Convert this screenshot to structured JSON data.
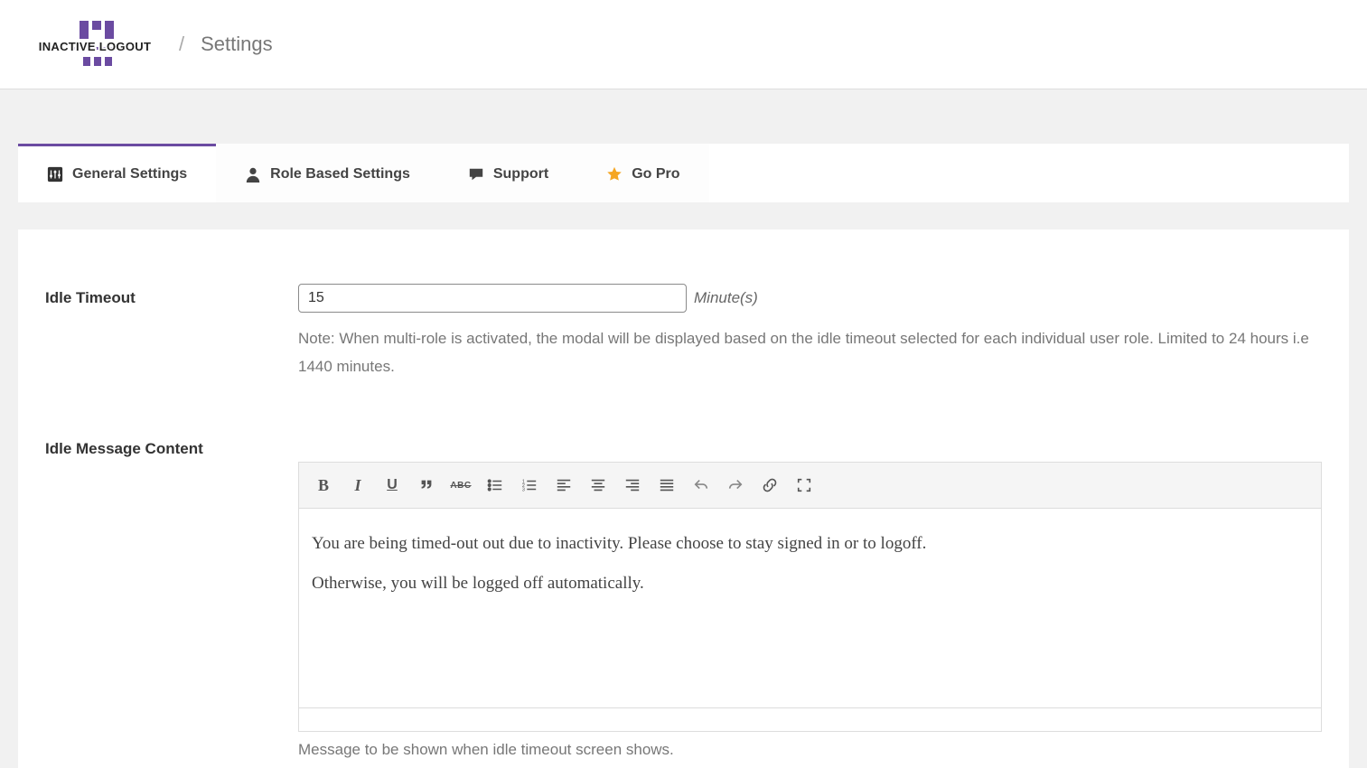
{
  "header": {
    "brand_top": "INACTIVE LOGOUT",
    "breadcrumb_sep": "/",
    "breadcrumb_title": "Settings"
  },
  "tabs": {
    "general": "General Settings",
    "role": "Role Based Settings",
    "support": "Support",
    "gopro": "Go Pro"
  },
  "form": {
    "idle_timeout_label": "Idle Timeout",
    "idle_timeout_value": "15",
    "idle_timeout_unit": "Minute(s)",
    "idle_timeout_help": "Note: When multi-role is activated, the modal will be displayed based on the idle timeout selected for each individual user role. Limited to 24 hours i.e 1440 minutes.",
    "idle_message_label": "Idle Message Content",
    "idle_message_p1": "You are being timed-out out due to inactivity. Please choose to stay signed in or to logoff.",
    "idle_message_p2": "Otherwise, you will be logged off automatically.",
    "idle_message_help": "Message to be shown when idle timeout screen shows."
  },
  "toolbar": {
    "bold": "B",
    "italic": "I",
    "underline": "U",
    "strike": "ABC"
  }
}
